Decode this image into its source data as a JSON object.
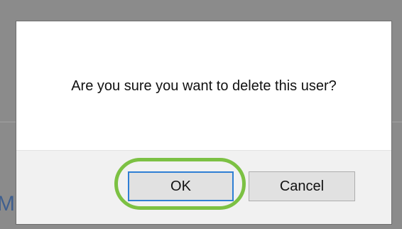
{
  "backdrop": {
    "partial_text": "M/"
  },
  "dialog": {
    "message": "Are you sure you want to delete this user?",
    "ok_label": "OK",
    "cancel_label": "Cancel"
  },
  "colors": {
    "highlight": "#7cc143",
    "ok_border": "#2f7fd4",
    "button_bg": "#e1e1e1",
    "footer_bg": "#f1f1f1"
  }
}
